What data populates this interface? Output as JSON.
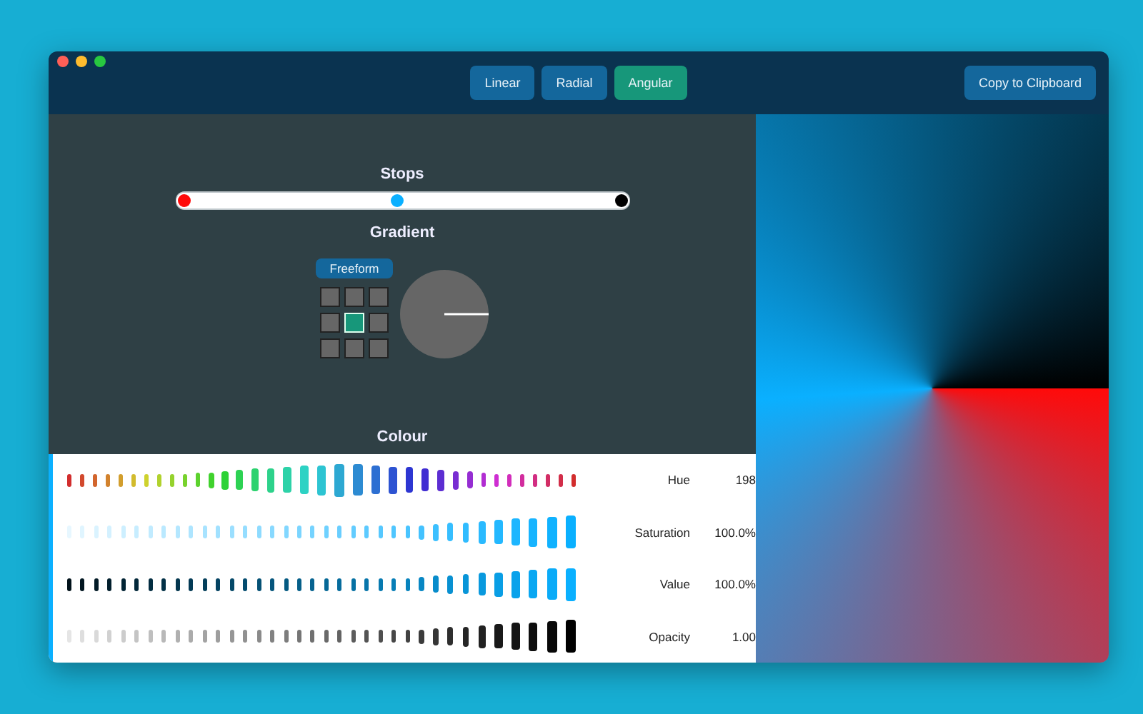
{
  "window": {
    "title_bar": {
      "tabs": [
        {
          "label": "Linear",
          "selected": false
        },
        {
          "label": "Radial",
          "selected": false
        },
        {
          "label": "Angular",
          "selected": true
        }
      ],
      "copy_button": "Copy to Clipboard"
    }
  },
  "stops": {
    "title": "Stops",
    "items": [
      {
        "color": "#ff0a0a",
        "level": 0
      },
      {
        "color": "#0ab0ff",
        "level": 0.49
      },
      {
        "color": "#000000",
        "level": 1
      }
    ]
  },
  "gradient": {
    "title": "Gradient",
    "mode_button": "Freeform",
    "anchors": [
      {
        "selected": false
      },
      {
        "selected": false
      },
      {
        "selected": false
      },
      {
        "selected": false
      },
      {
        "selected": true
      },
      {
        "selected": false
      },
      {
        "selected": false
      },
      {
        "selected": false
      },
      {
        "selected": false
      }
    ]
  },
  "colour": {
    "title": "Colour",
    "color": "#0ab0ff",
    "rows": [
      {
        "kind": "hue",
        "label": "Hue",
        "value": "198",
        "level": 0.55
      },
      {
        "kind": "saturation",
        "label": "Saturation",
        "value": "100.0%",
        "level": 1
      },
      {
        "kind": "value",
        "label": "Value",
        "value": "100.0%",
        "level": 1
      },
      {
        "kind": "opacity",
        "label": "Opacity",
        "value": "1.00",
        "level": 1
      }
    ]
  }
}
